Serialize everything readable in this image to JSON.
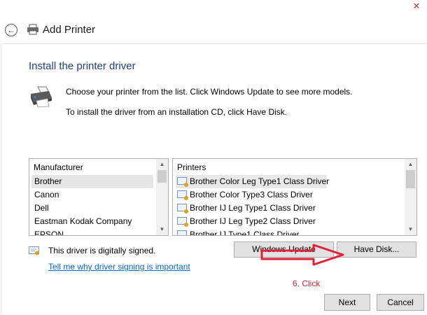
{
  "window": {
    "title": "Add Printer",
    "close_glyph": "✕",
    "back_glyph": "←"
  },
  "page": {
    "heading": "Install the printer driver",
    "description_line1": "Choose your printer from the list. Click Windows Update to see more models.",
    "description_line2": "To install the driver from an installation CD, click Have Disk."
  },
  "manufacturer_list": {
    "header": "Manufacturer",
    "items": [
      "Brother",
      "Canon",
      "Dell",
      "Eastman Kodak Company",
      "EPSON"
    ],
    "selected": "Brother"
  },
  "printers_list": {
    "header": "Printers",
    "items": [
      "Brother Color Leg Type1 Class Driver",
      "Brother Color Type3 Class Driver",
      "Brother IJ Leg Type1 Class Driver",
      "Brother IJ Leg Type2 Class Driver",
      "Brother IJ Type1 Class Driver"
    ],
    "selected": "Brother Color Leg Type1 Class Driver"
  },
  "signing": {
    "status_text": "This driver is digitally signed.",
    "link_text": "Tell me why driver signing is important"
  },
  "buttons": {
    "windows_update": "Windows Update",
    "have_disk": "Have Disk...",
    "next": "Next",
    "cancel": "Cancel"
  },
  "annotation": {
    "text": "6. Click",
    "color": "#e0213a"
  },
  "icons": {
    "back": "back-arrow-icon",
    "printer": "printer-icon",
    "certificate": "certificate-icon",
    "scroll_up": "scroll-up-icon",
    "scroll_down": "scroll-down-icon"
  }
}
